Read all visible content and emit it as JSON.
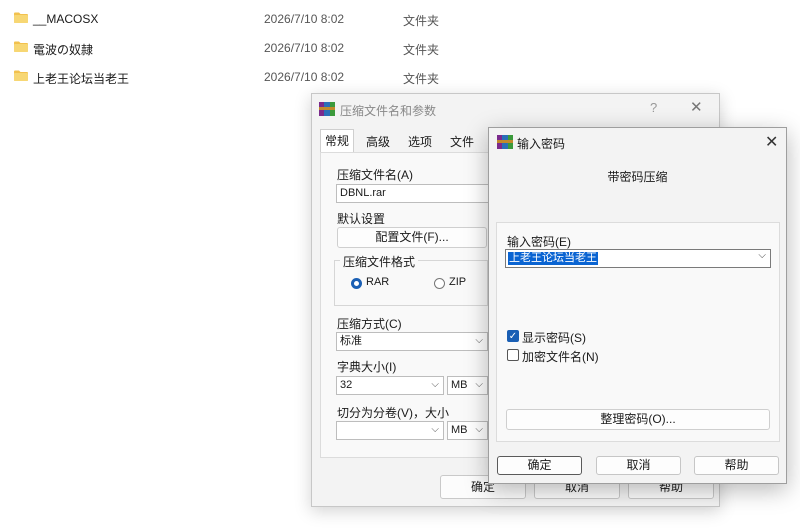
{
  "files": [
    {
      "name": "__MACOSX",
      "date": "2026/7/10 8:02",
      "type": "文件夹"
    },
    {
      "name": "電波の奴隷",
      "date": "2026/7/10 8:02",
      "type": "文件夹"
    },
    {
      "name": "上老王论坛当老王",
      "date": "2026/7/10 8:02",
      "type": "文件夹"
    }
  ],
  "archive_dialog": {
    "title": "压缩文件名和参数",
    "help_label": "?",
    "close_label": "✕",
    "tabs": [
      "常规",
      "高级",
      "选项",
      "文件"
    ],
    "archive_name_label": "压缩文件名(A)",
    "archive_name_value": "DBNL.rar",
    "default_settings_label": "默认设置",
    "profiles_button": "配置文件(F)...",
    "format_group_label": "压缩文件格式",
    "format_rar": "RAR",
    "format_zip": "ZIP",
    "method_label": "压缩方式(C)",
    "method_value": "标准",
    "dict_label": "字典大小(I)",
    "dict_value": "32",
    "dict_unit": "MB",
    "split_label": "切分为分卷(V)，大小",
    "split_value": "",
    "split_unit": "MB",
    "ok_button": "确定",
    "cancel_button": "取消",
    "help_button": "帮助"
  },
  "password_dialog": {
    "title": "输入密码",
    "close_label": "✕",
    "heading": "带密码压缩",
    "password_label": "输入密码(E)",
    "password_value": "上老王论坛当老王",
    "show_password_label": "显示密码(S)",
    "show_password_checked": true,
    "encrypt_names_label": "加密文件名(N)",
    "encrypt_names_checked": false,
    "organize_button": "整理密码(O)...",
    "ok_button": "确定",
    "cancel_button": "取消",
    "help_button": "帮助"
  },
  "colors": {
    "folder": "#f2c14e",
    "accent": "#1a5fb4",
    "selection": "#0a64d2"
  }
}
